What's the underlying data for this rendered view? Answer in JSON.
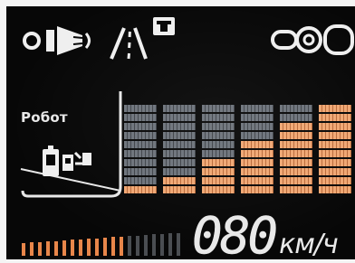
{
  "robot_mode": {
    "label": "Робот"
  },
  "speed": {
    "value": "080",
    "unit": "км/ч"
  },
  "equalizer": {
    "columns": [
      {
        "lit": 1,
        "total": 10
      },
      {
        "lit": 2,
        "total": 10
      },
      {
        "lit": 4,
        "total": 10
      },
      {
        "lit": 6,
        "total": 10
      },
      {
        "lit": 8,
        "total": 10
      },
      {
        "lit": 10,
        "total": 10
      }
    ]
  },
  "rpm": {
    "lit": 13,
    "total": 20
  },
  "colors": {
    "lit": "#f0a773",
    "unlit": "#6d737b",
    "text": "#e9e9e9",
    "background": "#070707"
  },
  "icons": [
    "sensor-wave-icon",
    "lane-assist-icon",
    "chain-link-icon",
    "robot-phone-icon"
  ]
}
